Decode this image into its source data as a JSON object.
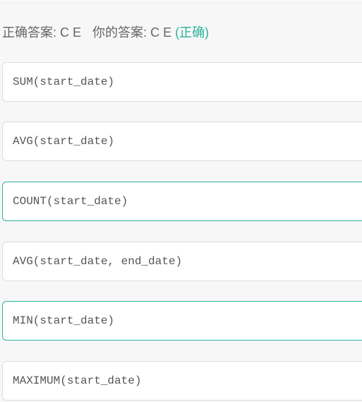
{
  "answer": {
    "correct_label": "正确答案:",
    "correct_value": "C E",
    "yours_label": "你的答案:",
    "yours_value": "C E",
    "status": "(正确)"
  },
  "options": [
    {
      "text": "SUM(start_date)",
      "selected": false
    },
    {
      "text": "AVG(start_date)",
      "selected": false
    },
    {
      "text": "COUNT(start_date)",
      "selected": true
    },
    {
      "text": "AVG(start_date, end_date)",
      "selected": false
    },
    {
      "text": "MIN(start_date)",
      "selected": true
    },
    {
      "text": "MAXIMUM(start_date)",
      "selected": false
    }
  ],
  "colors": {
    "correct_accent": "#2bb39b",
    "text": "#666666",
    "border": "#dddddd"
  }
}
